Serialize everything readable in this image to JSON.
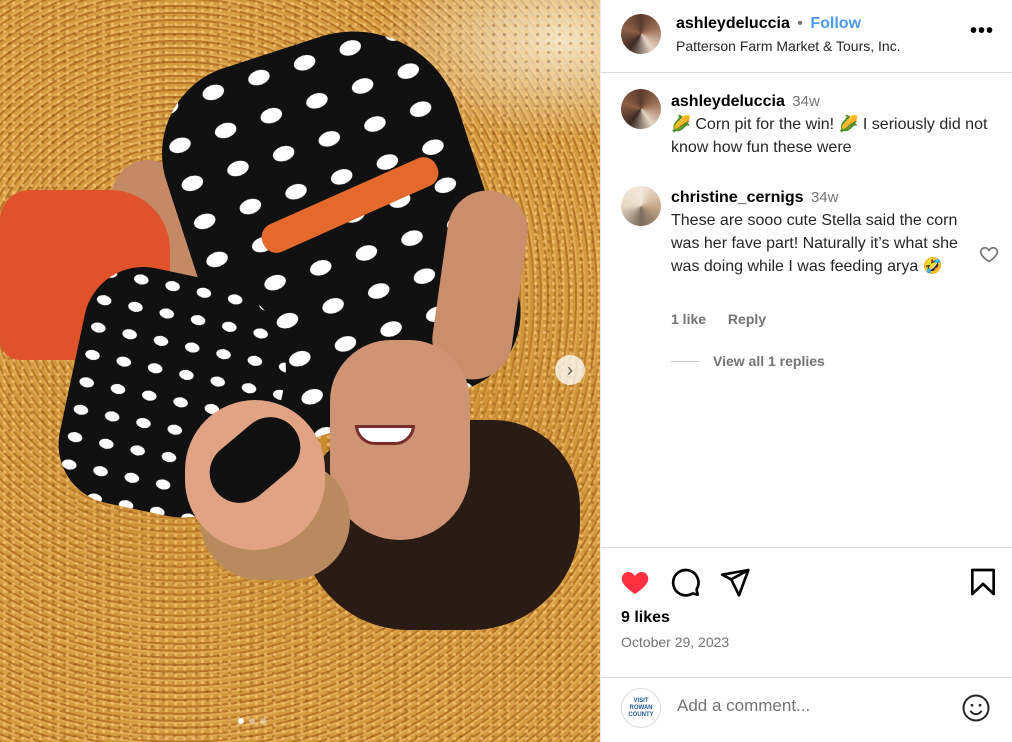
{
  "post": {
    "username": "ashleydeluccia",
    "separator": "•",
    "follow_label": "Follow",
    "location": "Patterson Farm Market & Tours, Inc.",
    "more_label": "•••"
  },
  "comments": [
    {
      "username": "ashleydeluccia",
      "time": "34w",
      "text": "🌽 Corn pit for the win! 🌽  I seriously did not know how fun these were"
    },
    {
      "username": "christine_cernigs",
      "time": "34w",
      "text": "These are sooo cute Stella said the corn was her fave part! Naturally it’s what she was doing while I was feeding arya 🤣",
      "likes_label": "1 like",
      "reply_label": "Reply",
      "view_replies_label": "View all 1 replies"
    }
  ],
  "actions": {
    "likes_label": "9 likes",
    "date": "October 29, 2023",
    "liked": true,
    "like_color": "#ff3040"
  },
  "add_comment": {
    "placeholder": "Add a comment...",
    "avatar_text_1": "VISIT",
    "avatar_text_2": "ROWAN",
    "avatar_text_3": "COUNTY"
  },
  "carousel": {
    "next_label": "›"
  },
  "icons": {
    "more": "more-options-icon",
    "like": "heart-icon",
    "comment": "comment-bubble-icon",
    "share": "paper-plane-icon",
    "save": "bookmark-icon",
    "emoji": "smiley-icon",
    "comment_like": "heart-outline-icon"
  }
}
